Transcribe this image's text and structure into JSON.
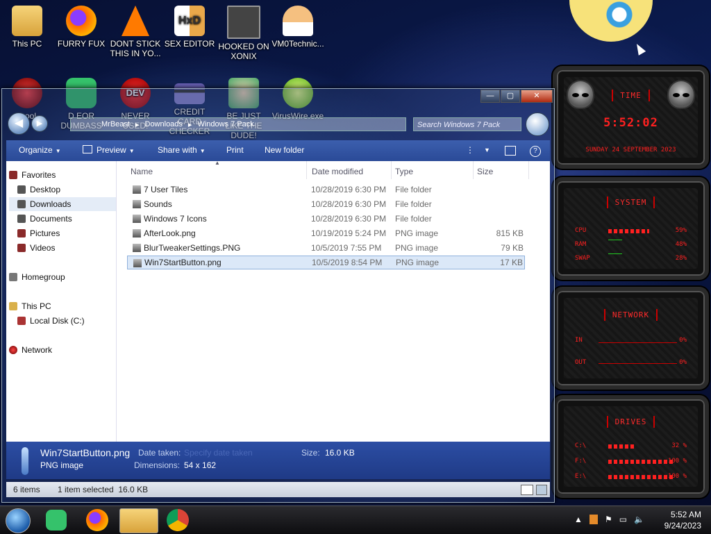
{
  "desktop_icons": [
    {
      "label": "This PC",
      "color": "#e2b34a"
    },
    {
      "label": "FURRY FUX",
      "color": "#ff6a00"
    },
    {
      "label": "DONT STICK THIS IN YO...",
      "color": "#ff7a00"
    },
    {
      "label": "SEX EDITOR",
      "color": "#e9b26c"
    },
    {
      "label": "HOOKED ON XONIX",
      "color": "#444"
    },
    {
      "label": "VM0Technic...",
      "color": "#f5c080"
    },
    {
      "label": "D EOR DUMBASS",
      "color": "#35c26b"
    },
    {
      "label": "NEVER USED!",
      "color": "#d22"
    },
    {
      "label": "CREDIT CARD CHECKER",
      "color": "#6a62b8"
    },
    {
      "label": "BE JUST LIKE THE DUDE!",
      "color": "#4aa86a"
    },
    {
      "label": "VirusWire.exe",
      "color": "#7ad12a"
    },
    {
      "label": "...ool",
      "color": "#b02020"
    }
  ],
  "widgets": {
    "time": {
      "title": "time",
      "clock": "5:52:02",
      "date": "Sunday 24 September 2023"
    },
    "system": {
      "title": "system",
      "rows": [
        {
          "label": "CPU",
          "value": "59%",
          "fill": 59
        },
        {
          "label": "RAM",
          "value": "48%",
          "fill": 48
        },
        {
          "label": "SWAP",
          "value": "28%",
          "fill": 28
        }
      ]
    },
    "network": {
      "title": "network",
      "rows": [
        {
          "label": "IN",
          "value": "0%"
        },
        {
          "label": "OUT",
          "value": "0%"
        }
      ]
    },
    "drives": {
      "title": "drives",
      "rows": [
        {
          "label": "C:\\",
          "value": "32 %",
          "fill": 32
        },
        {
          "label": "F:\\",
          "value": "100 %",
          "fill": 100
        },
        {
          "label": "E:\\",
          "value": "100 %",
          "fill": 100
        }
      ]
    }
  },
  "explorer": {
    "caption_buttons": {
      "minimize": "—",
      "maximize": "▢",
      "close": "✕"
    },
    "address": {
      "segments": [
        "MrBeast",
        "Downloads",
        "Windows 7 Pack"
      ]
    },
    "search": {
      "placeholder": "Search Windows 7 Pack"
    },
    "toolbar": {
      "organize": "Organize",
      "preview": "Preview",
      "share": "Share with",
      "print": "Print",
      "new_folder": "New folder"
    },
    "nav": {
      "favorites": "Favorites",
      "desktop": "Desktop",
      "downloads": "Downloads",
      "documents": "Documents",
      "pictures": "Pictures",
      "videos": "Videos",
      "homegroup": "Homegroup",
      "this_pc": "This PC",
      "local_disk": "Local Disk (C:)",
      "network": "Network"
    },
    "columns": {
      "name": "Name",
      "date": "Date modified",
      "type": "Type",
      "size": "Size"
    },
    "files": [
      {
        "name": "7 User Tiles",
        "date": "10/28/2019 6:30 PM",
        "type": "File folder",
        "size": ""
      },
      {
        "name": "Sounds",
        "date": "10/28/2019 6:30 PM",
        "type": "File folder",
        "size": ""
      },
      {
        "name": "Windows 7 Icons",
        "date": "10/28/2019 6:30 PM",
        "type": "File folder",
        "size": ""
      },
      {
        "name": "AfterLook.png",
        "date": "10/19/2019 5:24 PM",
        "type": "PNG image",
        "size": "815 KB"
      },
      {
        "name": "BlurTweakerSettings.PNG",
        "date": "10/5/2019 7:55 PM",
        "type": "PNG image",
        "size": "79 KB"
      },
      {
        "name": "Win7StartButton.png",
        "date": "10/5/2019 8:54 PM",
        "type": "PNG image",
        "size": "17 KB"
      }
    ],
    "details": {
      "filename": "Win7StartButton.png",
      "filetype": "PNG image",
      "date_taken_label": "Date taken:",
      "date_taken_value": "Specify date taken",
      "dimensions_label": "Dimensions:",
      "dimensions_value": "54 x 162",
      "size_label": "Size:",
      "size_value": "16.0 KB"
    },
    "status": {
      "count": "6 items",
      "selected": "1 item selected  16.0 KB"
    }
  },
  "taskbar": {
    "time": "5:52 AM",
    "date": "9/24/2023"
  }
}
